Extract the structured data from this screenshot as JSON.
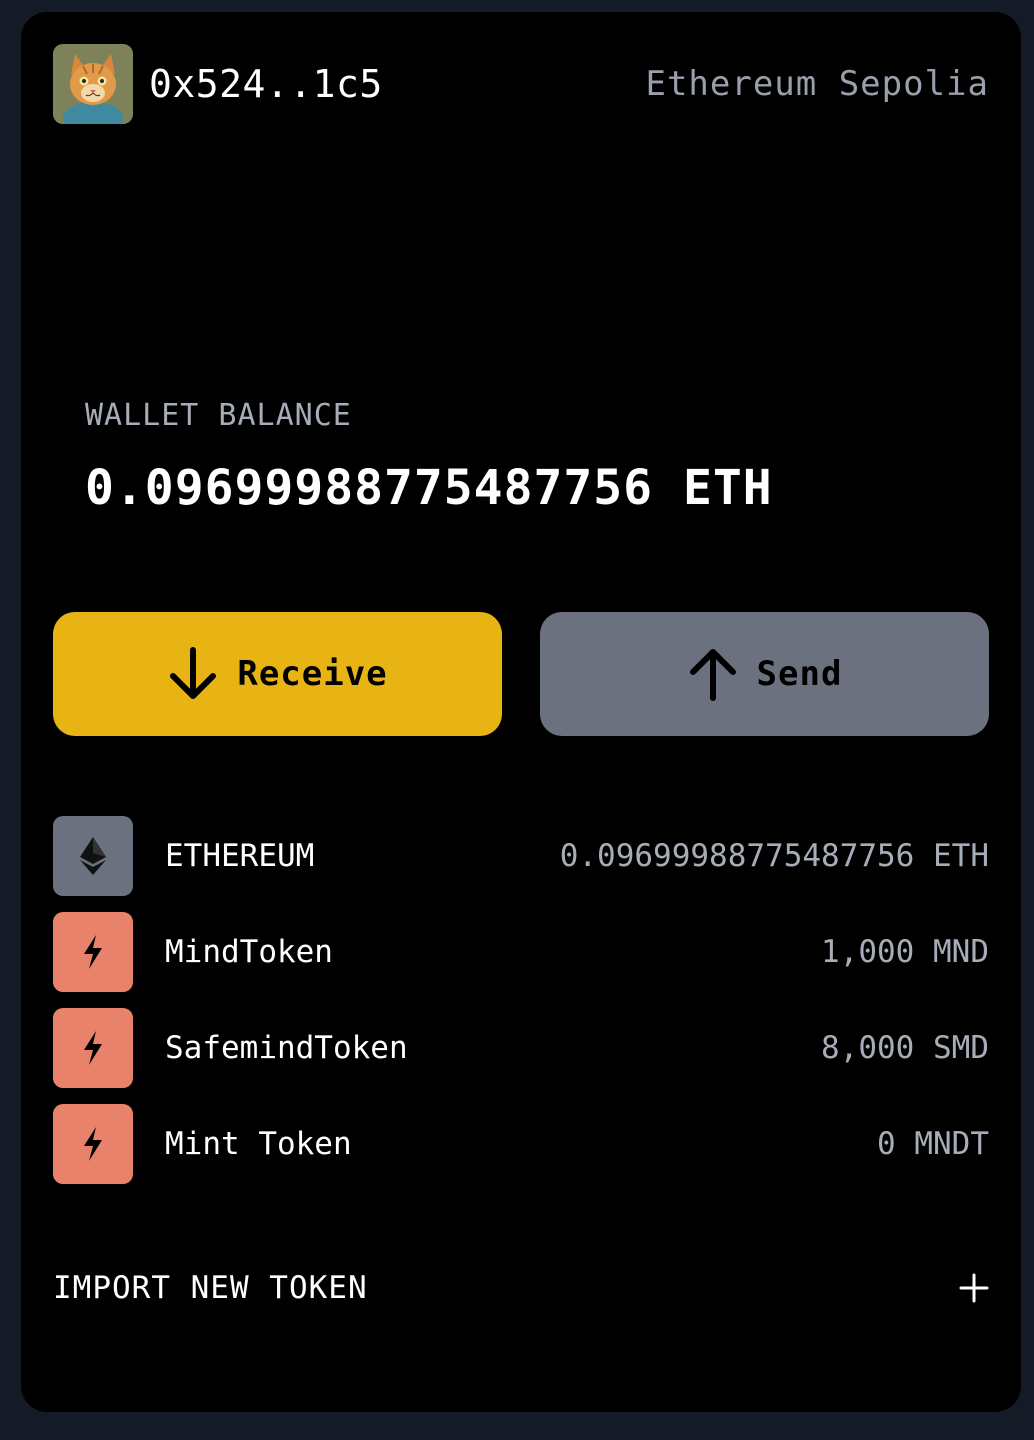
{
  "header": {
    "address": "0x524..1c5",
    "network": "Ethereum Sepolia",
    "avatar_icon": "cat-portrait-avatar"
  },
  "balance": {
    "label": "WALLET BALANCE",
    "value": "0.09699988775487756 ETH"
  },
  "actions": {
    "receive_label": "Receive",
    "receive_icon": "arrow-down-icon",
    "send_label": "Send",
    "send_icon": "arrow-up-icon"
  },
  "tokens": [
    {
      "name": "ETHEREUM",
      "amount": "0.09699988775487756 ETH",
      "icon": "ethereum-icon",
      "icon_bg": "#6c7180"
    },
    {
      "name": "MindToken",
      "amount": "1,000 MND",
      "icon": "lightning-icon",
      "icon_bg": "#e8826a"
    },
    {
      "name": "SafemindToken",
      "amount": "8,000 SMD",
      "icon": "lightning-icon",
      "icon_bg": "#e8826a"
    },
    {
      "name": "Mint Token",
      "amount": "0 MNDT",
      "icon": "lightning-icon",
      "icon_bg": "#e8826a"
    }
  ],
  "import": {
    "label": "IMPORT NEW TOKEN",
    "icon": "plus-icon"
  },
  "colors": {
    "receive_button": "#e8b414",
    "send_button": "#6c7180",
    "card_background": "#000000",
    "page_background": "#141a26"
  }
}
